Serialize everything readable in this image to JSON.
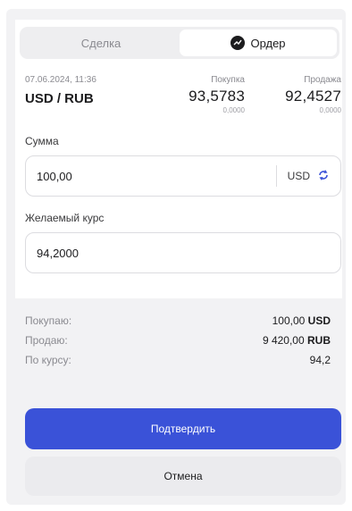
{
  "tabs": [
    {
      "label": "Сделка",
      "active": false
    },
    {
      "label": "Ордер",
      "active": true,
      "icon": "chart-trend-icon"
    }
  ],
  "quote": {
    "timestamp": "07.06.2024, 11:36",
    "pair": "USD / RUB",
    "buy": {
      "label": "Покупка",
      "value": "93,5783",
      "change": "0,0000"
    },
    "sell": {
      "label": "Продажа",
      "value": "92,4527",
      "change": "0,0000"
    }
  },
  "amount": {
    "label": "Сумма",
    "value": "100,00",
    "currency": "USD",
    "icon": "swap-currency-icon"
  },
  "rate": {
    "label": "Желаемый курс",
    "value": "94,2000"
  },
  "summary": {
    "buying": {
      "label": "Покупаю:",
      "amount": "100,00",
      "currency": "USD"
    },
    "selling": {
      "label": "Продаю:",
      "amount": "9 420,00",
      "currency": "RUB"
    },
    "rate": {
      "label": "По курсу:",
      "value": "94,2"
    }
  },
  "actions": {
    "confirm": "Подтвердить",
    "cancel": "Отмена"
  },
  "colors": {
    "primary": "#3a52d8",
    "accent_icon": "#3a52d8"
  }
}
